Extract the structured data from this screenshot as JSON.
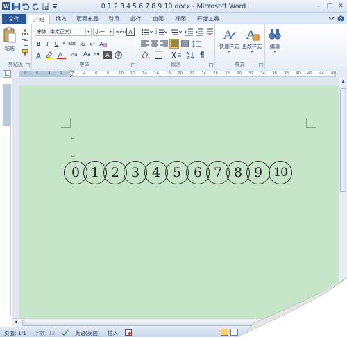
{
  "window": {
    "title": "0 1 2 3 4 5 6 7 8 9 10.docx - Microsoft Word",
    "controls": [
      "–",
      "□",
      "✕"
    ]
  },
  "ribbon_tabs": {
    "file": "文件",
    "tabs": [
      "开始",
      "插入",
      "页面布局",
      "引用",
      "邮件",
      "审阅",
      "视图",
      "开发工具"
    ],
    "active_index": 0
  },
  "ribbon": {
    "clipboard": {
      "label": "剪贴板",
      "paste": "粘贴"
    },
    "font": {
      "label": "字体",
      "font_name": "宋体 (中文正文)",
      "font_size": "小一",
      "bold": "B",
      "italic": "I",
      "underline": "U",
      "strike": "abc",
      "subscript": "x₂",
      "superscript": "x²",
      "grow": "A",
      "shrink": "A",
      "aa": "Aa"
    },
    "paragraph": {
      "label": "段落"
    },
    "styles": {
      "label": "样式",
      "quick_styles": "快速样式",
      "change_styles": "更改样式"
    },
    "editing": {
      "label": "编辑"
    }
  },
  "ruler": {
    "numbers": [
      "8",
      "6",
      "4",
      "2",
      "2",
      "4",
      "6",
      "8",
      "10",
      "12",
      "14",
      "16",
      "18",
      "20",
      "22",
      "24",
      "26",
      "28",
      "30",
      "32",
      "34",
      "36",
      "38",
      "40",
      "42",
      "44",
      "48"
    ]
  },
  "document": {
    "paragraph_marks": [
      "↵",
      "↵"
    ],
    "circled_numbers": [
      "0",
      "1",
      "2",
      "3",
      "4",
      "5",
      "6",
      "7",
      "8",
      "9",
      "10"
    ],
    "page_color": "#c6e5c9"
  },
  "statusbar": {
    "page": "页面: 1/1",
    "words": "字数: 12",
    "language": "英语(美国)",
    "mode": "插入"
  },
  "colors": {
    "file_tab": "#2b5797",
    "page_background": "#c6e5c9",
    "highlight_active": "#f8d26a"
  }
}
